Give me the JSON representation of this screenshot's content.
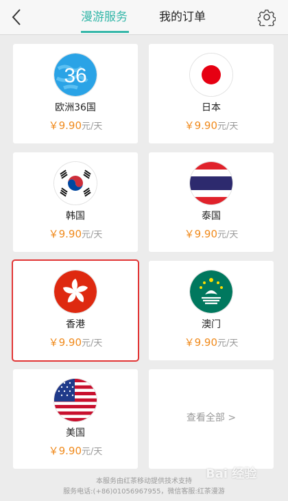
{
  "header": {
    "tab_roaming": "漫游服务",
    "tab_orders": "我的订单",
    "accent_color": "#33b6a8"
  },
  "cards": [
    {
      "country": "欧洲36国",
      "flag_icon": "europe-36-icon",
      "badge_text": "36",
      "price": "￥9.90",
      "unit": "元/天"
    },
    {
      "country": "日本",
      "flag_icon": "japan-flag-icon",
      "price": "￥9.90",
      "unit": "元/天"
    },
    {
      "country": "韩国",
      "flag_icon": "korea-flag-icon",
      "price": "￥9.90",
      "unit": "元/天"
    },
    {
      "country": "泰国",
      "flag_icon": "thailand-flag-icon",
      "price": "￥9.90",
      "unit": "元/天"
    },
    {
      "country": "香港",
      "flag_icon": "hongkong-flag-icon",
      "price": "￥9.90",
      "unit": "元/天",
      "selected": true
    },
    {
      "country": "澳门",
      "flag_icon": "macau-flag-icon",
      "price": "￥9.90",
      "unit": "元/天"
    },
    {
      "country": "美国",
      "flag_icon": "usa-flag-icon",
      "price": "￥9.90",
      "unit": "元/天"
    }
  ],
  "view_all": "查看全部 >",
  "footer": {
    "line1": "本服务由红茶移动提供技术支持",
    "line2": "服务电话:(+86)01056967955，微信客服:红茶漫游"
  },
  "watermark": "Bai 经验"
}
